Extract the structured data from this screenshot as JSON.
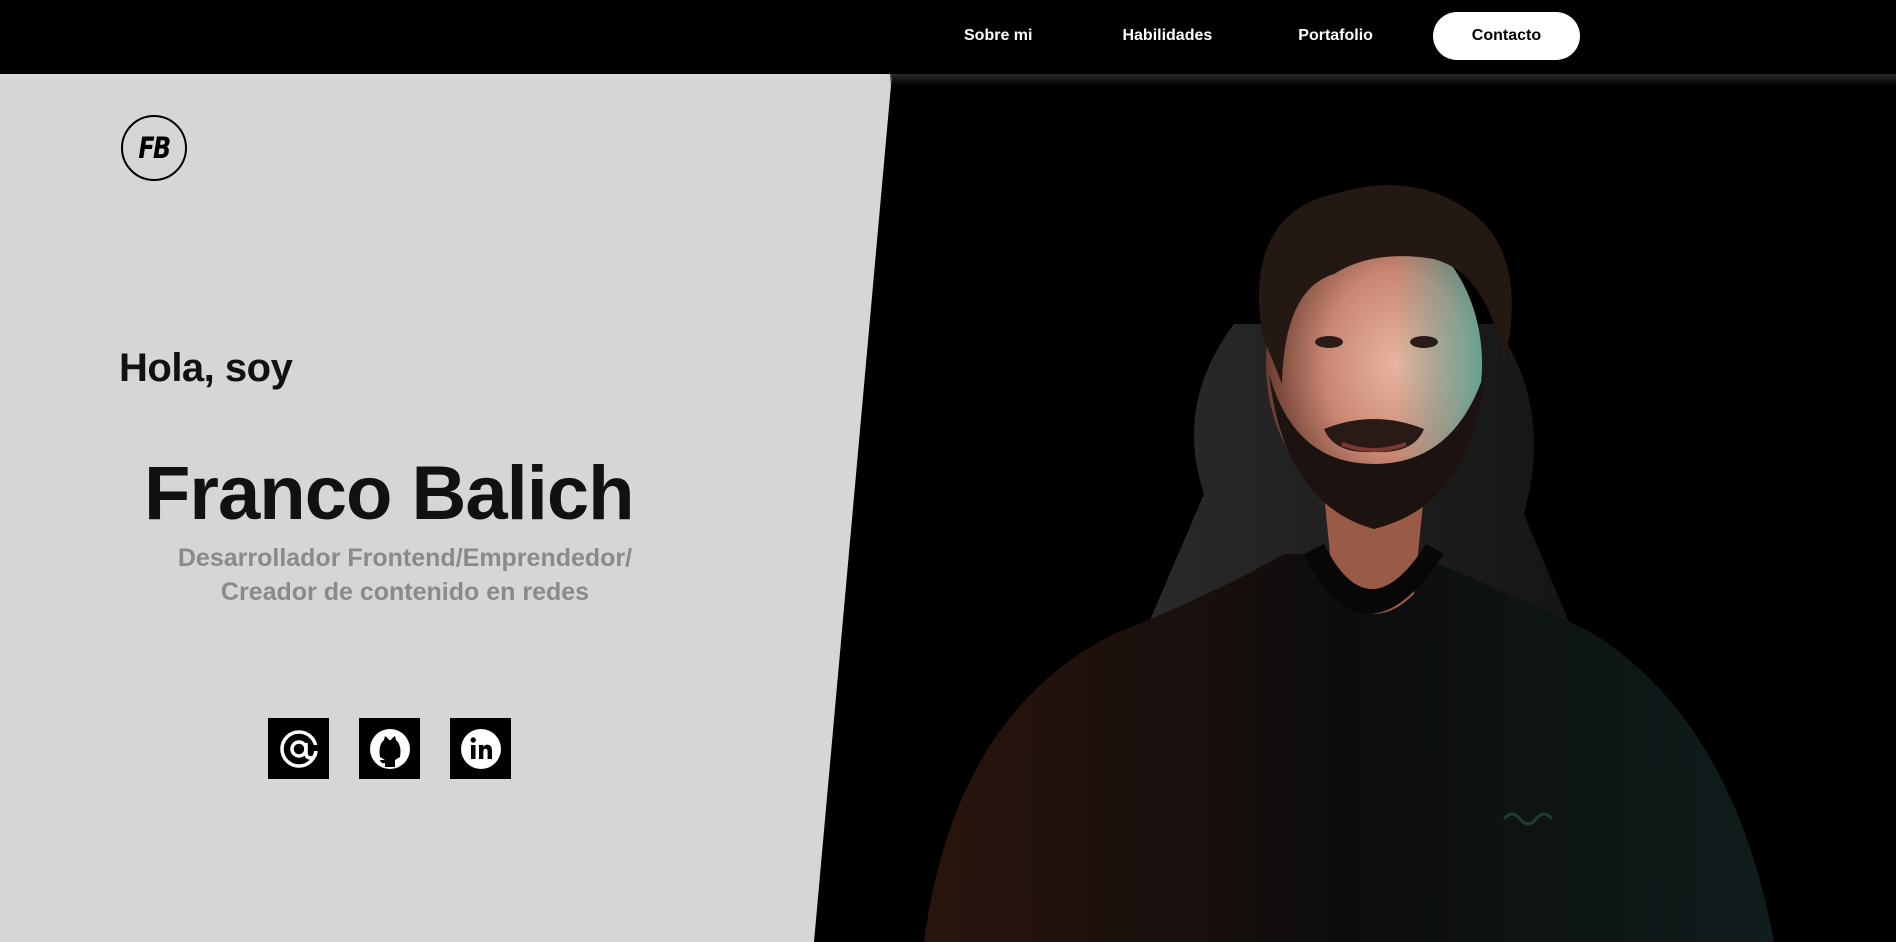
{
  "nav": {
    "items": [
      {
        "label": "Sobre mi"
      },
      {
        "label": "Habilidades"
      },
      {
        "label": "Portafolio"
      }
    ],
    "contact_label": "Contacto"
  },
  "logo": {
    "text": "FB"
  },
  "hero": {
    "greeting": "Hola, soy",
    "name": "Franco Balich",
    "role_line1": "Desarrollador Frontend/Emprendedor/",
    "role_line2": "Creador de contenido en redes"
  },
  "socials": [
    {
      "icon": "at-sign-icon"
    },
    {
      "icon": "github-icon"
    },
    {
      "icon": "linkedin-icon"
    }
  ],
  "colors": {
    "panel": "#d6d6d6",
    "background": "#000000",
    "muted_text": "#8a8a8a",
    "text": "#111111"
  }
}
